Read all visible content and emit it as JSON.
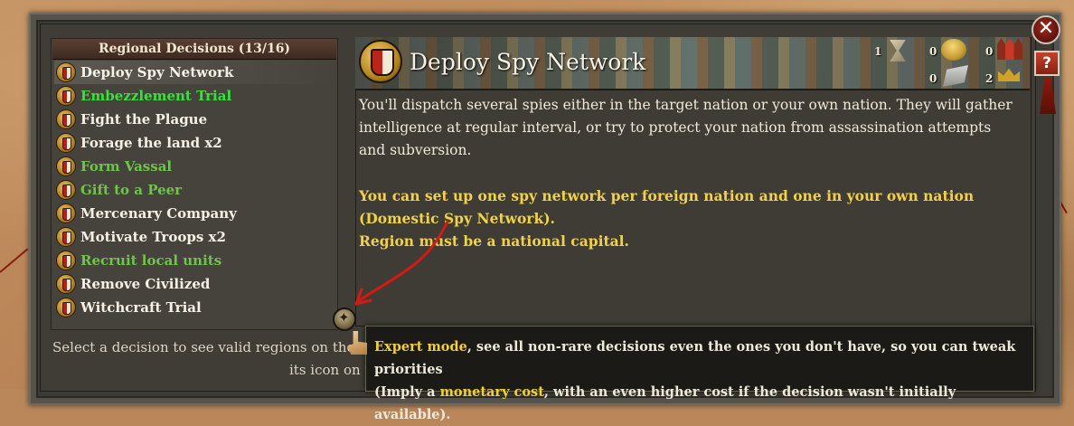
{
  "list": {
    "header": "Regional Decisions (13/16)",
    "items": [
      {
        "label": "Deploy Spy Network",
        "style": "selected"
      },
      {
        "label": "Embezzlement Trial",
        "style": "green-bright"
      },
      {
        "label": "Fight the Plague",
        "style": "normal"
      },
      {
        "label": "Forage the land x2",
        "style": "normal"
      },
      {
        "label": "Form Vassal",
        "style": "green"
      },
      {
        "label": "Gift to a Peer",
        "style": "green"
      },
      {
        "label": "Mercenary Company",
        "style": "normal"
      },
      {
        "label": "Motivate Troops x2",
        "style": "normal"
      },
      {
        "label": "Recruit local units",
        "style": "green"
      },
      {
        "label": "Remove Civilized",
        "style": "normal"
      },
      {
        "label": "Witchcraft Trial",
        "style": "normal"
      }
    ]
  },
  "detail": {
    "title": "Deploy Spy Network",
    "costs": {
      "turns": "1",
      "gold": "0",
      "troops": "0",
      "iron": "0",
      "crowns": "2"
    },
    "description": "You'll dispatch several spies either in the target nation or your own nation. They will gather intelligence at regular interval, or try to protect your nation from assassination attempts and subversion.",
    "requirement_1": "You can set up one spy network per foreign nation and one in your own nation (Domestic Spy Network).",
    "requirement_2": "Region must be a national capital."
  },
  "hint": {
    "line1": "Select a decision to see valid regions on the map",
    "line2": "its icon on t"
  },
  "tooltip": {
    "expert_label": "Expert mode",
    "text_1": ", see all non-rare decisions even the ones you don't have, so you can tweak priorities",
    "text_2_pre": "(Imply a ",
    "cost_label": "monetary cost",
    "text_2_post": ", with an even higher cost if the decision wasn't initially available)."
  },
  "buttons": {
    "close": "✕",
    "help": "?"
  },
  "colors": {
    "highlight_yellow": "#f1cf3b",
    "green_bright": "#35e43a",
    "green": "#6ec54a",
    "annotation_red": "#d41a12"
  }
}
